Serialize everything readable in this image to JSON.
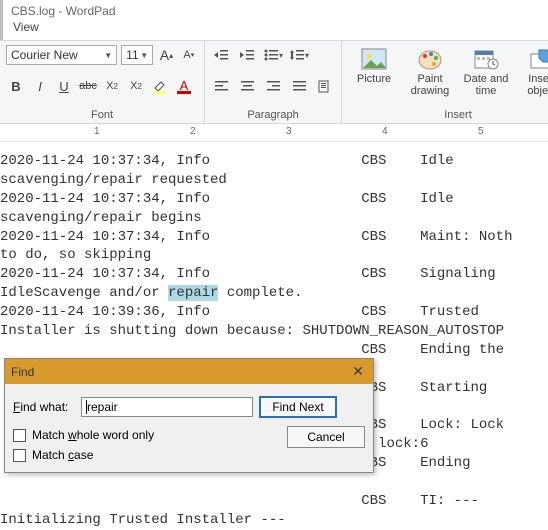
{
  "title": "CBS.log - WordPad",
  "menu": {
    "view": "View"
  },
  "font_group": {
    "label": "Font",
    "font_name": "Courier New",
    "font_size": "11"
  },
  "paragraph_group": {
    "label": "Paragraph"
  },
  "insert_group": {
    "label": "Insert",
    "picture": "Picture",
    "paint": "Paint drawing",
    "datetime": "Date and time",
    "object": "Insert object"
  },
  "ruler": {
    "n1": "1",
    "n2": "2",
    "n3": "3",
    "n4": "4",
    "n5": "5"
  },
  "doc": {
    "l1": "2020-11-24 10:37:34, Info                  CBS    Idle",
    "l2": "scavenging/repair requested",
    "l3": "2020-11-24 10:37:34, Info                  CBS    Idle",
    "l4": "scavenging/repair begins",
    "l5": "2020-11-24 10:37:34, Info                  CBS    Maint: Noth",
    "l6": "to do, so skipping",
    "l7": "2020-11-24 10:37:34, Info                  CBS    Signaling",
    "l8a": "IdleScavenge and/or ",
    "l8h": "repair",
    "l8b": " complete.",
    "l9": "2020-11-24 10:39:36, Info                  CBS    Trusted",
    "l10": "Installer is shutting down because: SHUTDOWN_REASON_AUTOSTOP",
    "l11": "                                           CBS    Ending the",
    "l12": "",
    "l13": "                                           CBS    Starting",
    "l14": "",
    "l15": "                                           CBS    Lock: Lock",
    "l16": "                                        otal lock:6",
    "l17": "                                           CBS    Ending",
    "l18": "",
    "l19": "                                           CBS    TI: ---",
    "l20": "Initializing Trusted Installer ---"
  },
  "find": {
    "title": "Find",
    "what_label": "Find what:",
    "what_value": "repair",
    "next": "Find Next",
    "cancel": "Cancel",
    "whole": "Match whole word only",
    "case": "Match case"
  }
}
